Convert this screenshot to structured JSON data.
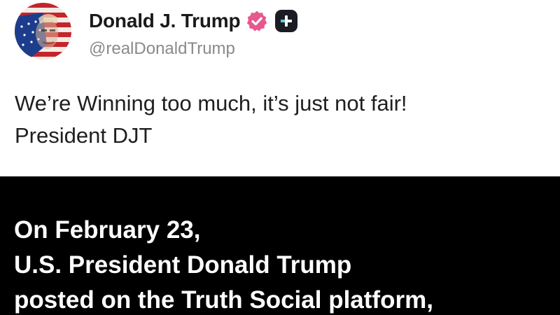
{
  "post": {
    "display_name": "Donald J. Trump",
    "handle": "@realDonaldTrump",
    "body_lines": [
      "We’re Winning too much, it’s just not fair!",
      "President DJT"
    ],
    "icons": {
      "avatar": "profile-avatar-flag-portrait",
      "verified": "verified-badge-icon",
      "plus": "plus-badge-icon"
    },
    "colors": {
      "verified_badge": "#e8578e",
      "plus_badge": "#1c1c24",
      "plus_accent": "#4fd3e0"
    }
  },
  "caption": {
    "lines": [
      "On February 23,",
      "U.S. President Donald Trump",
      "posted on the Truth Social platform,"
    ],
    "background": "#000000",
    "text_color": "#ffffff"
  }
}
